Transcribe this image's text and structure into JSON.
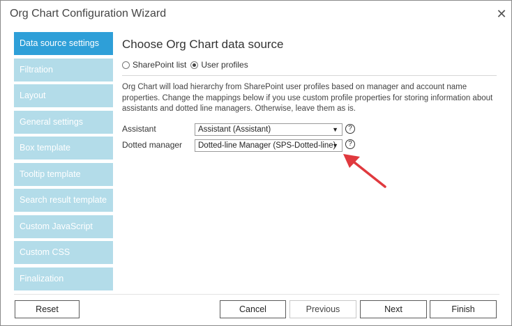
{
  "window": {
    "title": "Org Chart Configuration Wizard",
    "close_glyph": "✕"
  },
  "sidebar": {
    "items": [
      {
        "label": "Data source settings",
        "active": true
      },
      {
        "label": "Filtration"
      },
      {
        "label": "Layout"
      },
      {
        "label": "General settings"
      },
      {
        "label": "Box template"
      },
      {
        "label": "Tooltip template"
      },
      {
        "label": "Search result template"
      },
      {
        "label": "Custom JavaScript"
      },
      {
        "label": "Custom CSS"
      },
      {
        "label": "Finalization"
      }
    ]
  },
  "main": {
    "title": "Choose Org Chart data source",
    "source_options": [
      {
        "label": "SharePoint list",
        "checked": false
      },
      {
        "label": "User profiles",
        "checked": true
      }
    ],
    "description": "Org Chart will load hierarchy from SharePoint user profiles based on manager and account name properties. Change the mappings below if you use custom profile properties for storing information about assistants and dotted line managers. Otherwise, leave them as is.",
    "fields": {
      "assistant": {
        "label": "Assistant",
        "value": "Assistant (Assistant)"
      },
      "dotted_manager": {
        "label": "Dotted manager",
        "value": "Dotted-line Manager (SPS-Dotted-line)"
      }
    },
    "help_glyph": "?",
    "dropdown_glyph": "▼",
    "annotation_arrow_color": "#e0393e"
  },
  "footer": {
    "reset": "Reset",
    "cancel": "Cancel",
    "previous": "Previous",
    "next": "Next",
    "finish": "Finish"
  }
}
